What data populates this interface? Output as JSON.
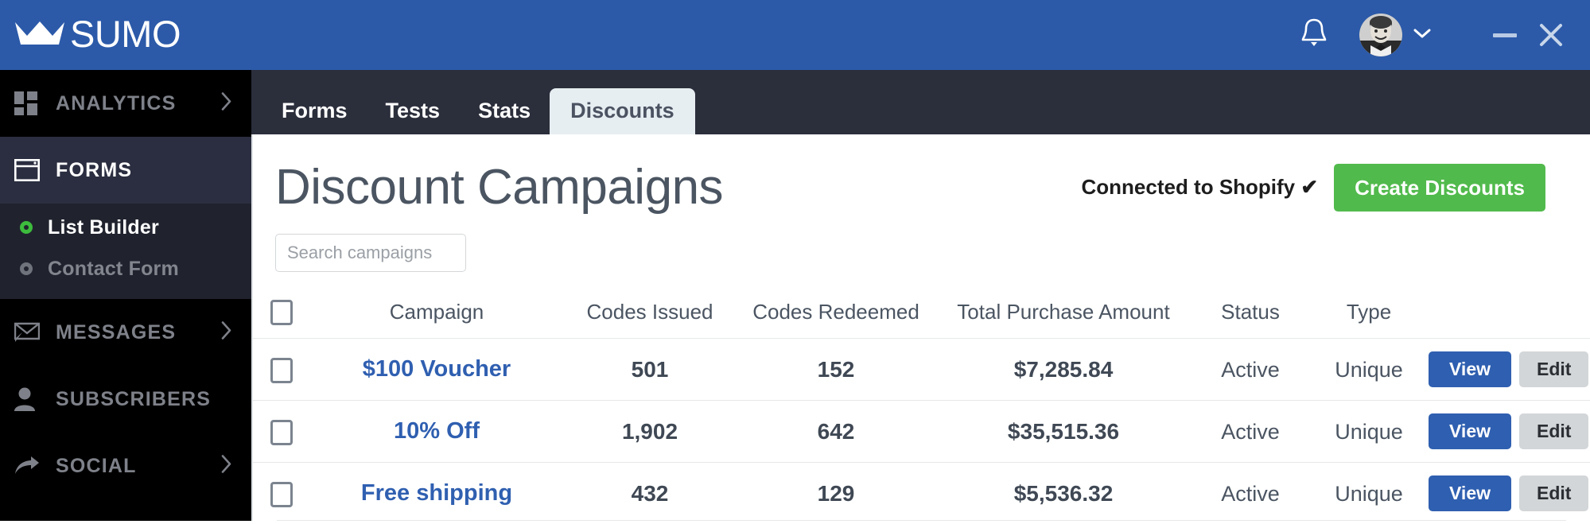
{
  "titlebar": {
    "brand": "SUMO",
    "crown_icon": "crown-icon",
    "notifications_icon": "bell-icon",
    "avatar_label": "user-avatar",
    "account_menu_icon": "chevron-down-icon",
    "minimize_label": "minimize-icon",
    "close_label": "close-icon",
    "bg_color": "#2c5aa9"
  },
  "sidebar": {
    "items": [
      {
        "label": "ANALYTICS",
        "icon": "grid-icon",
        "has_chevron": true,
        "active": false
      },
      {
        "label": "FORMS",
        "icon": "window-icon",
        "has_chevron": false,
        "active": true
      },
      {
        "label": "MESSAGES",
        "icon": "envelope-icon",
        "has_chevron": true,
        "active": false
      },
      {
        "label": "SUBSCRIBERS",
        "icon": "person-icon",
        "has_chevron": false,
        "active": false
      },
      {
        "label": "SOCIAL",
        "icon": "share-arrow-icon",
        "has_chevron": true,
        "active": false
      }
    ],
    "sub_items": [
      {
        "label": "List Builder",
        "active": true,
        "dot_color": "#3dbb3d"
      },
      {
        "label": "Contact Form",
        "active": false,
        "dot_color": "#6e737c"
      }
    ]
  },
  "tabs": [
    {
      "label": "Forms",
      "active": false
    },
    {
      "label": "Tests",
      "active": false
    },
    {
      "label": "Stats",
      "active": false
    },
    {
      "label": "Discounts",
      "active": true
    }
  ],
  "page": {
    "title": "Discount Campaigns",
    "connected_status": "Connected to Shopify ✔",
    "create_button": "Create Discounts",
    "create_button_color": "#51ba4c"
  },
  "search": {
    "value": "",
    "placeholder": "Search campaigns"
  },
  "table": {
    "headers": {
      "checkbox": "",
      "campaign": "Campaign",
      "codes_issued": "Codes Issued",
      "codes_redeemed": "Codes Redeemed",
      "total_purchase_amount": "Total Purchase Amount",
      "status": "Status",
      "type": "Type"
    },
    "view_label": "View",
    "edit_label": "Edit",
    "rows": [
      {
        "campaign": "$100 Voucher",
        "codes_issued": "501",
        "codes_redeemed": "152",
        "total_purchase_amount": "$7,285.84",
        "status": "Active",
        "type": "Unique"
      },
      {
        "campaign": "10% Off",
        "codes_issued": "1,902",
        "codes_redeemed": "642",
        "total_purchase_amount": "$35,515.36",
        "status": "Active",
        "type": "Unique"
      },
      {
        "campaign": "Free shipping",
        "codes_issued": "432",
        "codes_redeemed": "129",
        "total_purchase_amount": "$5,536.32",
        "status": "Active",
        "type": "Unique"
      }
    ]
  }
}
